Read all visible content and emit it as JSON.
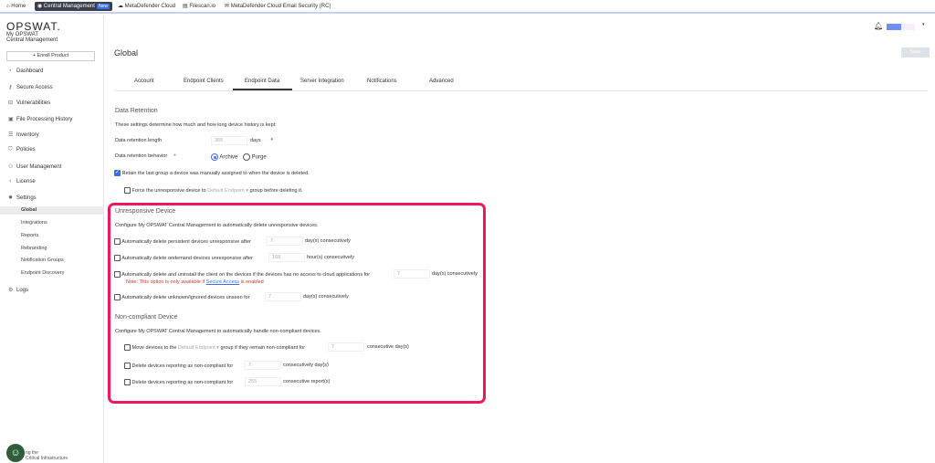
{
  "topbar": {
    "tabs": [
      {
        "label": "Home",
        "icon": "home-icon"
      },
      {
        "label": "Central Management",
        "badge": "New",
        "icon": "cm-icon"
      },
      {
        "label": "MetaDefender Cloud",
        "icon": "cloud-icon"
      },
      {
        "label": "Filescan.io",
        "icon": "filescan-icon"
      },
      {
        "label": "MetaDefender Cloud Email Security (RC)",
        "icon": "mail-icon"
      }
    ]
  },
  "brand": {
    "logo": "OPSWAT.",
    "line1": "My OPSWAT",
    "line2": "Central Management"
  },
  "sidebar": {
    "enroll": "+ Enroll Product",
    "items": [
      "Dashboard",
      "Secure Access",
      "Vulnerabilities",
      "File Processing History",
      "Inventory",
      "Policies",
      "User Management",
      "License",
      "Settings"
    ],
    "sub": [
      "Global",
      "Integrations",
      "Reports",
      "Rebranding",
      "Notification Groups",
      "Endpoint Discovery"
    ],
    "logs": "Logs",
    "footer1": "ng the",
    "footer2": "Critical Infrastructure"
  },
  "header": {
    "title": "Global",
    "save": "Save"
  },
  "tabs": [
    "Account",
    "Endpoint Clients",
    "Endpoint Data",
    "Server Integration",
    "Notifications",
    "Advanced"
  ],
  "retention": {
    "title": "Data Retention",
    "desc": "These settings determine how much and how long device history is kept:",
    "length_label": "Data retention length",
    "length_value": "365",
    "length_unit": "days",
    "behavior_label": "Data retention behavior",
    "archive": "Archive",
    "purge": "Purge",
    "retain": "Retain the last group a device was manually assigned to when the device is deleted.",
    "force_pre": "Force the unresponsive device to",
    "force_group": "Default Endpoint",
    "force_post": "group before deleting it."
  },
  "unresponsive": {
    "title": "Unresponsive Device",
    "desc": "Configure My OPSWAT Central Management to automatically delete unresponsive devices.",
    "r1": "Automatically delete persistent devices unresponsive after",
    "v1": "7",
    "u1": "day(s) consecutively",
    "r2": "Automatically delete ondemand devices unresponsive after",
    "v2": "168",
    "u2": "hour(s) consecutively",
    "r3": "Automatically delete and uninstall the client on the devices if the devices has no access to cloud applications for",
    "v3": "7",
    "u3": "day(s) consecutively",
    "note_pre": "Note: This option is only available if",
    "note_link": "Secure Access",
    "note_post": "is enabled",
    "r4": "Automatically delete unknown/ignored devices unseen for",
    "v4": "7",
    "u4": "day(s) consecutively"
  },
  "noncompliant": {
    "title": "Non-compliant Device",
    "desc": "Configure My OPSWAT Central Management to automatically handle non-compliant devices.",
    "m_pre": "Move devices to the",
    "m_group": "Default Endpoint",
    "m_post": "group if they remain non-compliant for",
    "m_val": "7",
    "m_unit": "consecutive day(s)",
    "d1": "Delete devices reporting as non-compliant for",
    "d1v": "7",
    "d1u": "consecutively day(s)",
    "d2": "Delete devices reporting as non-compliant for",
    "d2v": "255",
    "d2u": "consecutive report(s)"
  },
  "colors": {
    "accent": "#3d6ee8",
    "highlight": "#f0185a",
    "note": "#c0392b"
  }
}
